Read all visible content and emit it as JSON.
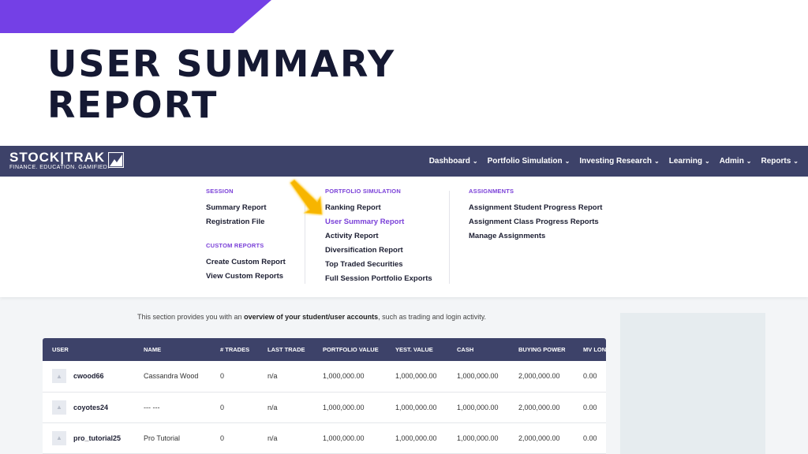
{
  "slide": {
    "title": "USER SUMMARY REPORT"
  },
  "brand": {
    "name": "STOCK|TRAK",
    "tagline": "FINANCE. EDUCATION. GAMIFIED.",
    "logo_icon": "stocktrak-mark-icon"
  },
  "nav": {
    "items": [
      {
        "label": "Dashboard"
      },
      {
        "label": "Portfolio Simulation"
      },
      {
        "label": "Investing Research"
      },
      {
        "label": "Learning"
      },
      {
        "label": "Admin"
      },
      {
        "label": "Reports"
      }
    ]
  },
  "dropdown": {
    "session": {
      "heading": "SESSION",
      "links": [
        "Summary Report",
        "Registration File"
      ]
    },
    "custom_reports": {
      "heading": "CUSTOM REPORTS",
      "links": [
        "Create Custom Report",
        "View Custom Reports"
      ]
    },
    "portfolio_simulation": {
      "heading": "PORTFOLIO SIMULATION",
      "links": [
        "Ranking Report",
        "User Summary Report",
        "Activity Report",
        "Diversification Report",
        "Top Traded Securities",
        "Full Session Portfolio Exports"
      ]
    },
    "assignments": {
      "heading": "ASSIGNMENTS",
      "links": [
        "Assignment Student Progress Report",
        "Assignment Class Progress Reports",
        "Manage Assignments"
      ]
    }
  },
  "intro": {
    "prefix": "This section provides you with an ",
    "bold": "overview of your student/user accounts",
    "suffix": ", such as trading and login activity."
  },
  "table": {
    "headers": [
      "USER",
      "NAME",
      "# TRADES",
      "LAST TRADE",
      "PORTFOLIO VALUE",
      "YEST. VALUE",
      "CASH",
      "BUYING POWER",
      "MV LONG"
    ],
    "rows": [
      {
        "user": "cwood66",
        "name": "Cassandra Wood",
        "trades": "0",
        "last_trade": "n/a",
        "portfolio_value": "1,000,000.00",
        "yest_value": "1,000,000.00",
        "cash": "1,000,000.00",
        "buying_power": "2,000,000.00",
        "mv_long": "0.00"
      },
      {
        "user": "coyotes24",
        "name": "--- ---",
        "trades": "0",
        "last_trade": "n/a",
        "portfolio_value": "1,000,000.00",
        "yest_value": "1,000,000.00",
        "cash": "1,000,000.00",
        "buying_power": "2,000,000.00",
        "mv_long": "0.00"
      },
      {
        "user": "pro_tutorial25",
        "name": "Pro Tutorial",
        "trades": "0",
        "last_trade": "n/a",
        "portfolio_value": "1,000,000.00",
        "yest_value": "1,000,000.00",
        "cash": "1,000,000.00",
        "buying_power": "2,000,000.00",
        "mv_long": "0.00"
      }
    ]
  },
  "colors": {
    "accent": "#7440e6",
    "nav_bg": "#3d4269",
    "title": "#151933",
    "highlight_arrow": "#f5b400"
  }
}
